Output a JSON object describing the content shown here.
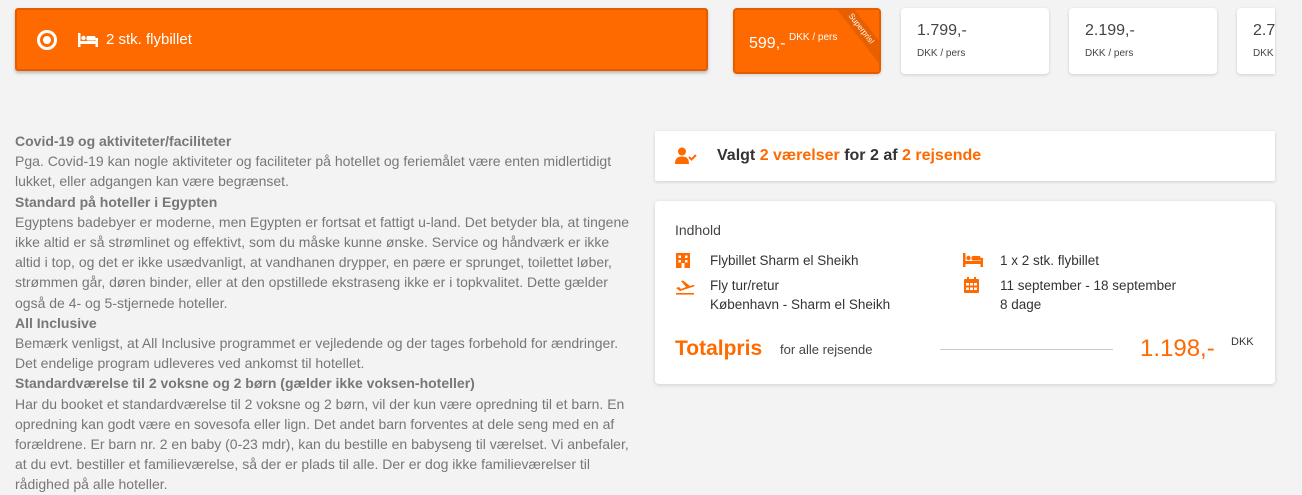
{
  "room_option": {
    "label": "2 stk. flybillet",
    "icons": [
      "radio-selected-icon",
      "bed-icon"
    ]
  },
  "price_cards": [
    {
      "amount": "599,-",
      "unit": "DKK / pers",
      "badge": "Superpris!",
      "selected": true
    },
    {
      "amount": "1.799,-",
      "unit": "DKK / pers",
      "selected": false
    },
    {
      "amount": "2.199,-",
      "unit": "DKK / pers",
      "selected": false
    },
    {
      "amount": "2.7",
      "unit": "DKK",
      "selected": false
    }
  ],
  "description": {
    "sections": [
      {
        "heading": "Covid-19 og aktiviteter/faciliteter",
        "body": "Pga. Covid-19 kan nogle aktiviteter og faciliteter på hotellet og feriemålet være enten midlertidigt lukket, eller adgangen kan være begrænset."
      },
      {
        "heading": "Standard på hoteller i Egypten",
        "body": "Egyptens badebyer er moderne, men Egypten er fortsat et fattigt u-land. Det betyder bla, at tingene ikke altid er så strømlinet og effektivt, som du måske kunne ønske. Service og håndværk er ikke altid i top, og det er ikke usædvanligt, at vandhanen drypper, en pære er sprunget, toilettet løber, strømmen går, døren binder, eller at den opstillede ekstraseng ikke er i topkvalitet. Dette gælder også de 4- og 5-stjernede hoteller."
      },
      {
        "heading": "All Inclusive",
        "body": "Bemærk venligst, at All Inclusive programmet er vejledende og der tages forbehold for ændringer. Det endelige program udleveres ved ankomst til hotellet."
      },
      {
        "heading": "Standardværelse til 2 voksne og 2 børn (gælder ikke voksen-hoteller)",
        "body": "Har du booket et standardværelse til 2 voksne og 2 børn, vil der kun være opredning til et barn. En opredning kan godt være en sovesofa eller lign. Det andet barn forventes at dele seng med en af forældrene. Er barn nr. 2 en baby (0-23 mdr), kan du bestille en babyseng til værelset. Vi anbefaler, at du evt. bestiller et familieværelse, så der er plads til alle. Der  er dog ikke familieværelser til rådighed på alle hoteller."
      }
    ]
  },
  "selection": {
    "prefix": "Valgt",
    "rooms": "2 værelser",
    "middle": "for 2 af",
    "travelers": "2 rejsende",
    "icon": "user-check-icon"
  },
  "content": {
    "title": "Indhold",
    "hotel": "Flybillet Sharm el Sheikh",
    "flight_type": "Fly tur/retur",
    "route": "København - Sharm el Sheikh",
    "room_count": "1 x 2 stk. flybillet",
    "dates": "11 september - 18 september",
    "duration": "8 dage",
    "total_label": "Totalpris",
    "total_sub": "for alle rejsende",
    "total_amount": "1.198,-",
    "currency": "DKK"
  },
  "colors": {
    "accent": "#ff6a00",
    "text_muted": "#777777",
    "background": "#f3f3f3"
  }
}
